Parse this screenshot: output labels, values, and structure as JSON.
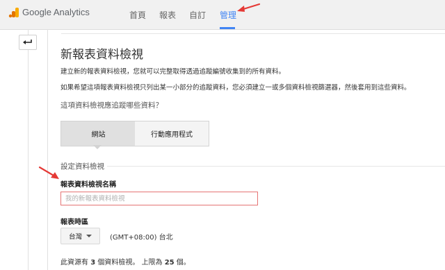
{
  "header": {
    "brand": "Google Analytics",
    "nav": [
      {
        "label": "首頁"
      },
      {
        "label": "報表"
      },
      {
        "label": "自訂"
      },
      {
        "label": "管理",
        "active": true
      }
    ]
  },
  "colors": {
    "accent": "#4285f4",
    "annotation_arrow": "#e53935",
    "error_border": "#e57373",
    "logo_orange": "#f9ab00",
    "logo_dark_orange": "#e37400"
  },
  "icons": {
    "back": "return-arrow-icon",
    "logo": "analytics-logo-icon"
  },
  "page": {
    "title": "新報表資料檢視",
    "para1": "建立新的報表資料檢視，您就可以完整取得透過追蹤編號收集到的所有資料。",
    "para2": "如果希望這項報表資料檢視只列出某一小部分的追蹤資料，您必須建立一或多個資料檢視篩選器，然後套用到這些資料。",
    "question": "這項資料檢視應追蹤哪些資料？",
    "segments": [
      {
        "label": "網站",
        "selected": true
      },
      {
        "label": "行動應用程式",
        "selected": false
      }
    ],
    "settings_heading": "設定資料檢視",
    "name_field": {
      "label": "報表資料檢視名稱",
      "placeholder": "我的新報表資料檢視",
      "value": ""
    },
    "timezone": {
      "label": "報表時區",
      "country": "台灣",
      "value": "(GMT+08:00) 台北"
    },
    "footer": {
      "prefix": "此資源有 ",
      "count": "3",
      "middle": " 個資料檢視。 上限為 ",
      "limit": "25",
      "suffix": " 個。"
    }
  }
}
